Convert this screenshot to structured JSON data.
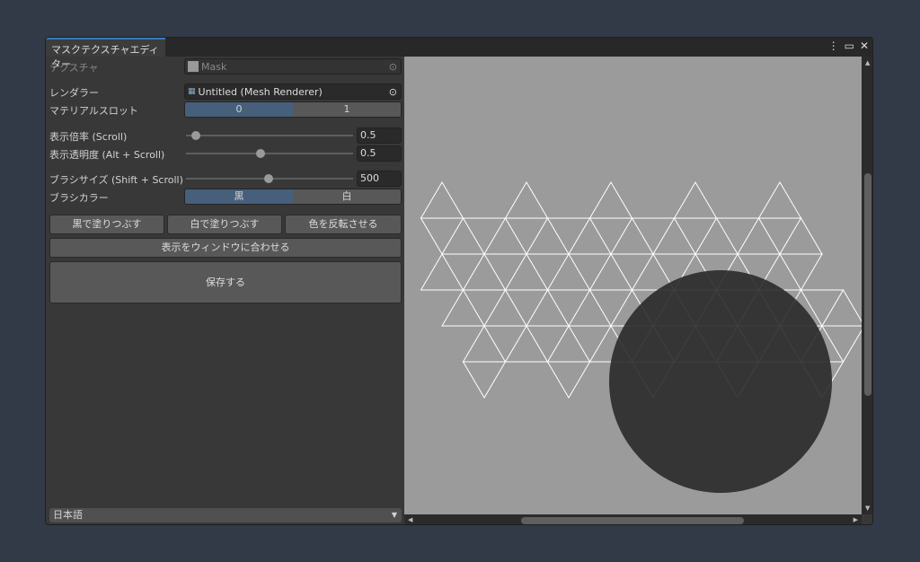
{
  "window": {
    "tab_title": "マスクテクスチャエディター",
    "menu_icon": "kebab-menu-icon",
    "maximize_icon": "maximize-icon",
    "close_icon": "close-icon"
  },
  "fields": {
    "texture": {
      "label": "テクスチャ",
      "value": "Mask"
    },
    "renderer": {
      "label": "レンダラー",
      "value": "Untitled (Mesh Renderer)"
    },
    "material_slot": {
      "label": "マテリアルスロット",
      "options": [
        "0",
        "1"
      ],
      "selected": 0
    },
    "zoom": {
      "label": "表示倍率 (Scroll)",
      "value": "0.5",
      "fraction": 0.05
    },
    "opacity": {
      "label": "表示透明度 (Alt + Scroll)",
      "value": "0.5",
      "fraction": 0.5
    },
    "brush_size": {
      "label": "ブラシサイズ (Shift + Scroll)",
      "value": "500",
      "fraction": 0.5
    },
    "brush_color": {
      "label": "ブラシカラー",
      "options": [
        "黒",
        "白"
      ],
      "selected": 0
    }
  },
  "buttons": {
    "fill_black": "黒で塗りつぶす",
    "fill_white": "白で塗りつぶす",
    "invert": "色を反転させる",
    "fit": "表示をウィンドウに合わせる",
    "save": "保存する"
  },
  "language": {
    "selected": "日本語"
  },
  "colors": {
    "accent": "#46607c",
    "canvas": "#9b9b9b",
    "brush": "#2a2a2a"
  }
}
